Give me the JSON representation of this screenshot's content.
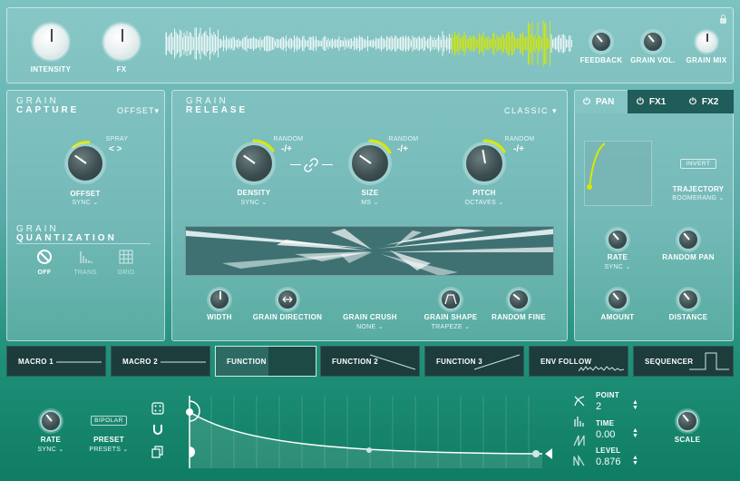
{
  "top": {
    "knobs": [
      {
        "label": "INTENSITY"
      },
      {
        "label": "FX"
      },
      {
        "label": "FEEDBACK"
      },
      {
        "label": "GRAIN VOL."
      },
      {
        "label": "GRAIN MIX"
      }
    ]
  },
  "capture": {
    "title1": "GRAIN",
    "title2": "CAPTURE",
    "mode": "OFFSET",
    "spray_label": "SPRAY",
    "spray_symbol": "< >",
    "knob_label": "OFFSET",
    "knob_sub": "SYNC",
    "quant_title1": "GRAIN",
    "quant_title2": "QUANTIZATION",
    "quant_options": [
      {
        "label": "OFF",
        "icon": "off-circle-icon"
      },
      {
        "label": "TRANS.",
        "icon": "transient-icon"
      },
      {
        "label": "GRID",
        "icon": "grid-icon"
      }
    ]
  },
  "release": {
    "title1": "GRAIN",
    "title2": "RELEASE",
    "mode": "CLASSIC",
    "random_label": "RANDOM",
    "random_value": "-/+",
    "knobs": [
      {
        "label": "DENSITY",
        "sub": "SYNC"
      },
      {
        "label": "SIZE",
        "sub": "MS"
      },
      {
        "label": "PITCH",
        "sub": "OCTAVES"
      }
    ],
    "bottom_knobs": [
      {
        "label": "WIDTH",
        "sub": ""
      },
      {
        "label": "GRAIN DIRECTION",
        "sub": ""
      },
      {
        "label": "GRAIN CRUSH",
        "sub": "NONE"
      },
      {
        "label": "GRAIN SHAPE",
        "sub": "TRAPEZE"
      },
      {
        "label": "RANDOM FINE",
        "sub": ""
      }
    ]
  },
  "pan": {
    "tabs": [
      "PAN",
      "FX1",
      "FX2"
    ],
    "invert_label": "INVERT",
    "trajectory_label": "TRAJECTORY",
    "trajectory_value": "BOOMERANG",
    "knobs": [
      {
        "label": "RATE",
        "sub": "SYNC"
      },
      {
        "label": "RANDOM PAN",
        "sub": ""
      },
      {
        "label": "AMOUNT",
        "sub": ""
      },
      {
        "label": "DISTANCE",
        "sub": ""
      }
    ]
  },
  "mod_tabs": [
    "MACRO 1",
    "MACRO 2",
    "FUNCTION 1",
    "FUNCTION 2",
    "FUNCTION 3",
    "ENV FOLLOW",
    "SEQUENCER"
  ],
  "function": {
    "rate_label": "RATE",
    "rate_sub": "SYNC",
    "bipolar_label": "BIPOLAR",
    "preset_label": "PRESET",
    "preset_sub": "PRESETS",
    "point_label": "POINT",
    "point_value": "2",
    "time_label": "TIME",
    "time_value": "0.00",
    "level_label": "LEVEL",
    "level_value": "0.876",
    "scale_label": "SCALE"
  },
  "colors": {
    "accent": "#d8e800",
    "tab_active": "#2d6a63",
    "tab_dark": "#1d3c3c"
  }
}
